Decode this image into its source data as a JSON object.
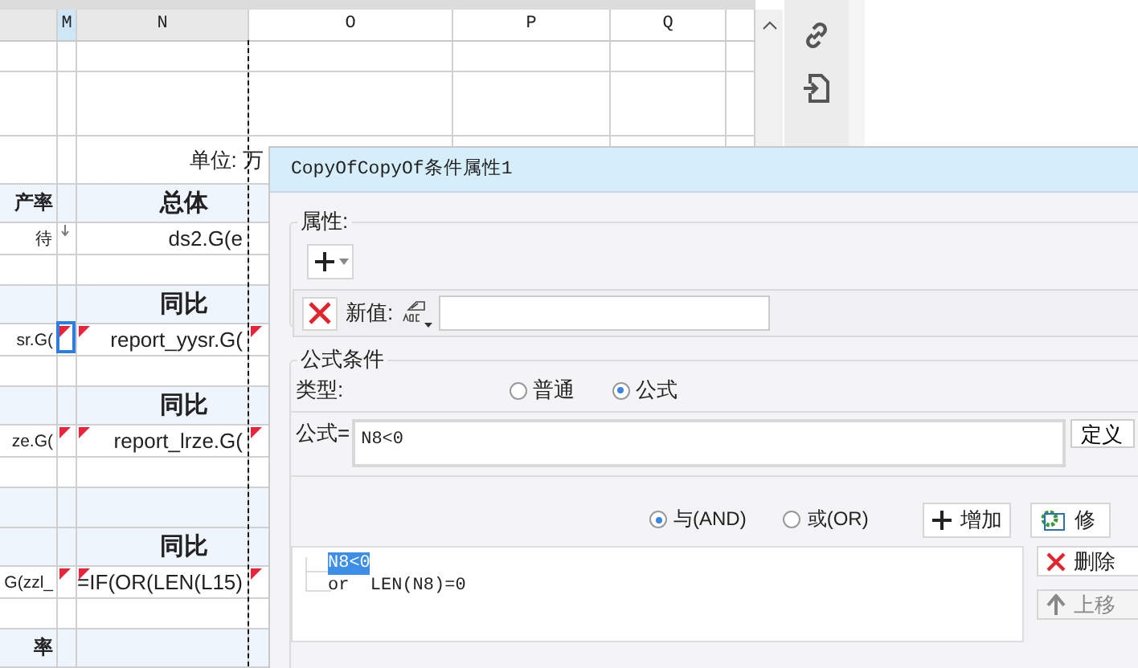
{
  "sheet": {
    "column_headers": [
      {
        "label": "M",
        "selected": true
      },
      {
        "label": "N",
        "selected": false
      },
      {
        "label": "O",
        "selected": false
      },
      {
        "label": "P",
        "selected": false
      },
      {
        "label": "Q",
        "selected": false
      }
    ],
    "rows": [
      {
        "kind": "blank",
        "cells": []
      },
      {
        "kind": "tall",
        "cells": []
      },
      {
        "kind": "unit",
        "cells": [
          {},
          {},
          {
            "text": "单位: 万"
          },
          {}
        ]
      },
      {
        "kind": "header",
        "cells": [
          {
            "text": "产率"
          },
          {},
          {
            "text": "总体"
          },
          {}
        ]
      },
      {
        "kind": "data",
        "cells": [
          {
            "text": "待"
          },
          {
            "arrow": true
          },
          {
            "text": "ds2.G(e"
          },
          {}
        ]
      },
      {
        "kind": "blank",
        "cells": []
      },
      {
        "kind": "header",
        "cells": [
          {},
          {},
          {
            "text": "同比"
          },
          {}
        ]
      },
      {
        "kind": "data",
        "cells": [
          {
            "text": "sr.G("
          },
          {
            "flagged": true,
            "selected": true
          },
          {
            "text": "report_yysr.G(",
            "flagged": true
          },
          {
            "flagged": true
          }
        ]
      },
      {
        "kind": "blank",
        "cells": []
      },
      {
        "kind": "header",
        "cells": [
          {},
          {},
          {
            "text": "同比"
          },
          {}
        ]
      },
      {
        "kind": "data",
        "cells": [
          {
            "text": "ze.G("
          },
          {
            "flagged": true
          },
          {
            "text": "report_lrze.G(",
            "flagged": true
          },
          {
            "flagged": true
          }
        ]
      },
      {
        "kind": "blank",
        "cells": []
      },
      {
        "kind": "band",
        "cells": []
      },
      {
        "kind": "header",
        "cells": [
          {},
          {},
          {
            "text": "同比"
          },
          {}
        ]
      },
      {
        "kind": "data",
        "cells": [
          {
            "text": "G(zzl_"
          },
          {
            "flagged": true
          },
          {
            "text": "=IF(OR(LEN(L15)",
            "flagged": true
          },
          {
            "flagged": true
          }
        ]
      },
      {
        "kind": "blank",
        "cells": []
      },
      {
        "kind": "header",
        "cells": [
          {
            "text": "率"
          },
          {},
          {},
          {}
        ]
      }
    ]
  },
  "dialog": {
    "title": "CopyOfCopyOf条件属性1",
    "properties": {
      "legend": "属性:",
      "new_value_label": "新值:"
    },
    "formula_condition": {
      "legend": "公式条件",
      "type_label": "类型:",
      "types": [
        {
          "label": "普通",
          "selected": false
        },
        {
          "label": "公式",
          "selected": true
        }
      ],
      "formula_label": "公式=",
      "formula": "N8<0",
      "define_button": "定义",
      "logic": [
        {
          "label": "与(AND)",
          "selected": true
        },
        {
          "label": "或(OR)",
          "selected": false
        }
      ],
      "add_button": "增加",
      "modify_button": "修",
      "conditions": [
        {
          "text": "N8<0",
          "selected": true
        },
        {
          "text": "or  LEN(N8)=0",
          "selected": false
        }
      ],
      "delete_button": "删除",
      "move_up_button": {
        "label": "上移",
        "disabled": true
      }
    }
  }
}
